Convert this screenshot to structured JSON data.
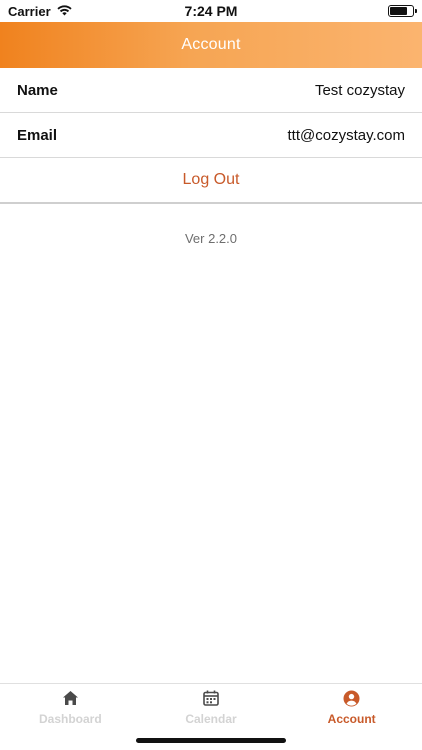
{
  "status_bar": {
    "carrier": "Carrier",
    "time": "7:24 PM"
  },
  "header": {
    "title": "Account"
  },
  "account": {
    "name_label": "Name",
    "name_value": "Test cozystay",
    "email_label": "Email",
    "email_value": "ttt@cozystay.com",
    "logout_label": "Log Out"
  },
  "version": "Ver 2.2.0",
  "tabs": [
    {
      "label": "Dashboard",
      "icon": "home-icon",
      "active": false
    },
    {
      "label": "Calendar",
      "icon": "calendar-icon",
      "active": false
    },
    {
      "label": "Account",
      "icon": "user-circle-icon",
      "active": true
    }
  ],
  "colors": {
    "accent": "#c85a2a",
    "header_start": "#f0821e",
    "header_end": "#fbb46f",
    "inactive_tab": "#d3d3d3"
  }
}
